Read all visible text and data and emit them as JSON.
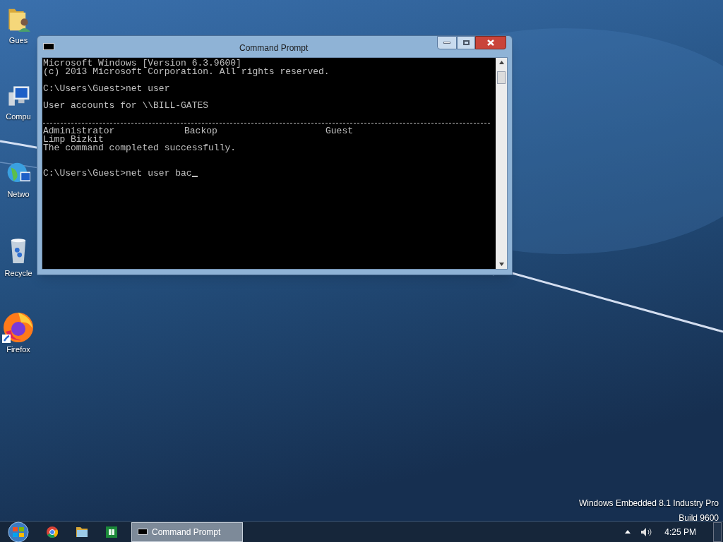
{
  "desktop_icons": [
    {
      "kind": "folder",
      "label": "Gues"
    },
    {
      "kind": "computer",
      "label": "Compu"
    },
    {
      "kind": "network",
      "label": "Netwo"
    },
    {
      "kind": "recycle",
      "label": "Recycle"
    },
    {
      "kind": "firefox",
      "label": "Firefox"
    }
  ],
  "window": {
    "title": "Command Prompt",
    "console": [
      {
        "kind": "text",
        "text": "Microsoft Windows [Version 6.3.9600]"
      },
      {
        "kind": "text",
        "text": "(c) 2013 Microsoft Corporation. All rights reserved."
      },
      {
        "kind": "blank"
      },
      {
        "kind": "text",
        "text": "C:\\Users\\Guest>net user"
      },
      {
        "kind": "blank"
      },
      {
        "kind": "text",
        "text": "User accounts for \\\\BILL-GATES"
      },
      {
        "kind": "blank"
      },
      {
        "kind": "rule"
      },
      {
        "kind": "columns",
        "cells": [
          "Administrator",
          "Backop",
          "Guest"
        ]
      },
      {
        "kind": "text",
        "text": "Limp Bizkit"
      },
      {
        "kind": "text",
        "text": "The command completed successfully."
      },
      {
        "kind": "blank"
      },
      {
        "kind": "blank"
      },
      {
        "kind": "input",
        "text": "C:\\Users\\Guest>net user bac"
      }
    ]
  },
  "watermark_text": [
    "Windows Embedded 8.1 Industry Pro",
    "Build 9600"
  ],
  "taskbar": {
    "pinned": [
      {
        "kind": "chrome"
      },
      {
        "kind": "explorer"
      },
      {
        "kind": "store"
      }
    ],
    "tasks": [
      {
        "label": "Command Prompt",
        "selected": true
      }
    ],
    "clock": "4:25 PM"
  }
}
